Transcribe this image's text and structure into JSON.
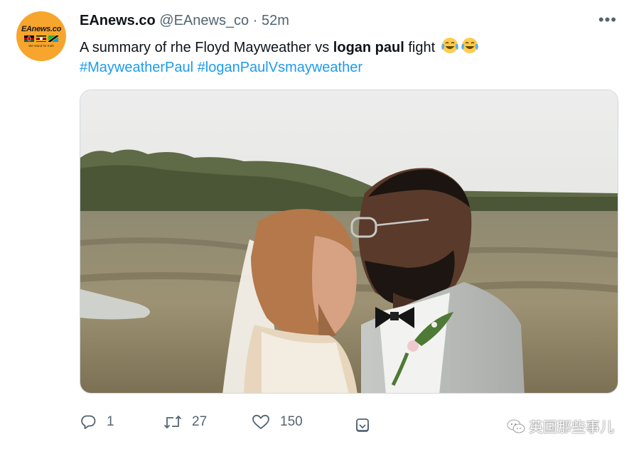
{
  "tweet": {
    "avatar": {
      "brand": "EAnews.co",
      "tagline": "We stand for truth"
    },
    "display_name": "EAnews.co",
    "handle": "@EAnews_co",
    "separator": "·",
    "time": "52m",
    "more_label": "•••",
    "text_prefix": "A summary of rhe Floyd Mayweather vs ",
    "text_bold": "logan paul",
    "text_suffix": " fight",
    "emojis": [
      "face-with-tears-of-joy-icon",
      "face-with-tears-of-joy-icon"
    ],
    "hashtags": [
      "#MayweatherPaul",
      "#loganPaulVsmayweather"
    ],
    "actions": {
      "replies": "1",
      "retweets": "27",
      "likes": "150"
    }
  },
  "watermark": {
    "text": "英国那些事儿"
  },
  "colors": {
    "accent": "#1d9bf0",
    "muted": "#536471",
    "text": "#0f1419",
    "avatar_bg": "#f7a52c"
  }
}
